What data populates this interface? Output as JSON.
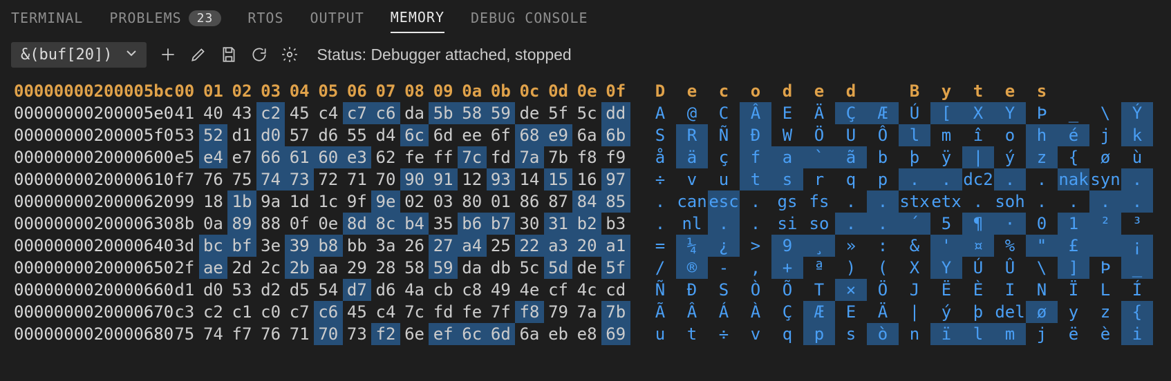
{
  "tabs": [
    {
      "id": "terminal",
      "label": "TERMINAL"
    },
    {
      "id": "problems",
      "label": "PROBLEMS",
      "badge": "23"
    },
    {
      "id": "rtos",
      "label": "RTOS"
    },
    {
      "id": "output",
      "label": "OUTPUT"
    },
    {
      "id": "memory",
      "label": "MEMORY",
      "active": true
    },
    {
      "id": "debugconsole",
      "label": "DEBUG CONSOLE"
    }
  ],
  "toolbar": {
    "expression": "&(buf[20])",
    "status": "Status: Debugger attached, stopped"
  },
  "header": {
    "address": "00000000200005bc",
    "cols": [
      "00",
      "01",
      "02",
      "03",
      "04",
      "05",
      "06",
      "07",
      "08",
      "09",
      "0a",
      "0b",
      "0c",
      "0d",
      "0e",
      "0f"
    ],
    "decoded": [
      "D",
      "e",
      "c",
      "o",
      "d",
      "e",
      "d",
      "",
      "B",
      "y",
      "t",
      "e",
      "s",
      "",
      "",
      ""
    ]
  },
  "rows": [
    {
      "addr": "00000000200005e0",
      "hex": [
        "41",
        "40",
        "43",
        "c2",
        "45",
        "c4",
        "c7",
        "c6",
        "da",
        "5b",
        "58",
        "59",
        "de",
        "5f",
        "5c",
        "dd"
      ],
      "hl": [
        0,
        0,
        0,
        1,
        0,
        0,
        1,
        1,
        0,
        1,
        1,
        1,
        0,
        0,
        0,
        1
      ],
      "dec": [
        "A",
        "@",
        "C",
        "Â",
        "E",
        "Ä",
        "Ç",
        "Æ",
        "Ú",
        "[",
        "X",
        "Y",
        "Þ",
        "_",
        "\\",
        "Ý"
      ]
    },
    {
      "addr": "00000000200005f0",
      "hex": [
        "53",
        "52",
        "d1",
        "d0",
        "57",
        "d6",
        "55",
        "d4",
        "6c",
        "6d",
        "ee",
        "6f",
        "68",
        "e9",
        "6a",
        "6b"
      ],
      "hl": [
        0,
        1,
        0,
        1,
        0,
        0,
        0,
        0,
        1,
        0,
        0,
        0,
        1,
        1,
        0,
        1
      ],
      "dec": [
        "S",
        "R",
        "Ñ",
        "Ð",
        "W",
        "Ö",
        "U",
        "Ô",
        "l",
        "m",
        "î",
        "o",
        "h",
        "é",
        "j",
        "k"
      ]
    },
    {
      "addr": "0000000020000600",
      "hex": [
        "e5",
        "e4",
        "e7",
        "66",
        "61",
        "60",
        "e3",
        "62",
        "fe",
        "ff",
        "7c",
        "fd",
        "7a",
        "7b",
        "f8",
        "f9"
      ],
      "hl": [
        0,
        1,
        0,
        1,
        1,
        1,
        1,
        0,
        0,
        0,
        1,
        0,
        1,
        0,
        0,
        0
      ],
      "dec": [
        "å",
        "ä",
        "ç",
        "f",
        "a",
        "`",
        "ã",
        "b",
        "þ",
        "ÿ",
        "|",
        "ý",
        "z",
        "{",
        "ø",
        "ù"
      ]
    },
    {
      "addr": "0000000020000610",
      "hex": [
        "f7",
        "76",
        "75",
        "74",
        "73",
        "72",
        "71",
        "70",
        "90",
        "91",
        "12",
        "93",
        "14",
        "15",
        "16",
        "97"
      ],
      "hl": [
        0,
        0,
        0,
        1,
        1,
        0,
        0,
        0,
        1,
        1,
        0,
        1,
        0,
        1,
        0,
        1
      ],
      "dec": [
        "÷",
        "v",
        "u",
        "t",
        "s",
        "r",
        "q",
        "p",
        ".",
        ".",
        "dc2",
        ".",
        ".",
        "nak",
        "syn",
        "."
      ]
    },
    {
      "addr": "0000000020000620",
      "hex": [
        "99",
        "18",
        "1b",
        "9a",
        "1d",
        "1c",
        "9f",
        "9e",
        "02",
        "03",
        "80",
        "01",
        "86",
        "87",
        "84",
        "85"
      ],
      "hl": [
        0,
        0,
        1,
        0,
        0,
        0,
        0,
        1,
        0,
        0,
        0,
        0,
        0,
        0,
        1,
        1
      ],
      "dec": [
        ".",
        "can",
        "esc",
        ".",
        "gs",
        "fs",
        ".",
        ".",
        "stx",
        "etx",
        ".",
        "soh",
        ".",
        ".",
        ".",
        "."
      ]
    },
    {
      "addr": "0000000020000630",
      "hex": [
        "8b",
        "0a",
        "89",
        "88",
        "0f",
        "0e",
        "8d",
        "8c",
        "b4",
        "35",
        "b6",
        "b7",
        "30",
        "31",
        "b2",
        "b3"
      ],
      "hl": [
        0,
        0,
        1,
        0,
        0,
        0,
        1,
        1,
        1,
        0,
        1,
        1,
        0,
        1,
        1,
        0
      ],
      "dec": [
        ".",
        "nl",
        ".",
        ".",
        "si",
        "so",
        ".",
        ".",
        "´",
        "5",
        "¶",
        "·",
        "0",
        "1",
        "²",
        "³"
      ]
    },
    {
      "addr": "0000000020000640",
      "hex": [
        "3d",
        "bc",
        "bf",
        "3e",
        "39",
        "b8",
        "bb",
        "3a",
        "26",
        "27",
        "a4",
        "25",
        "22",
        "a3",
        "20",
        "a1"
      ],
      "hl": [
        0,
        1,
        1,
        0,
        1,
        1,
        0,
        0,
        0,
        1,
        1,
        0,
        1,
        1,
        1,
        1
      ],
      "dec": [
        "=",
        "¼",
        "¿",
        ">",
        "9",
        "¸",
        "»",
        ":",
        "&",
        "'",
        "¤",
        "%",
        "\"",
        "£",
        " ",
        "¡"
      ]
    },
    {
      "addr": "0000000020000650",
      "hex": [
        "2f",
        "ae",
        "2d",
        "2c",
        "2b",
        "aa",
        "29",
        "28",
        "58",
        "59",
        "da",
        "db",
        "5c",
        "5d",
        "de",
        "5f"
      ],
      "hl": [
        0,
        1,
        0,
        0,
        1,
        0,
        0,
        0,
        0,
        1,
        0,
        0,
        0,
        1,
        0,
        1
      ],
      "dec": [
        "/",
        "®",
        "-",
        ",",
        "+",
        "ª",
        ")",
        "(",
        "X",
        "Y",
        "Ú",
        "Û",
        "\\",
        "]",
        "Þ",
        "_"
      ]
    },
    {
      "addr": "0000000020000660",
      "hex": [
        "d1",
        "d0",
        "53",
        "d2",
        "d5",
        "54",
        "d7",
        "d6",
        "4a",
        "cb",
        "c8",
        "49",
        "4e",
        "cf",
        "4c",
        "cd"
      ],
      "hl": [
        0,
        0,
        0,
        0,
        0,
        0,
        1,
        0,
        0,
        0,
        0,
        0,
        0,
        0,
        0,
        0
      ],
      "dec": [
        "Ñ",
        "Ð",
        "S",
        "Ò",
        "Õ",
        "T",
        "×",
        "Ö",
        "J",
        "Ë",
        "È",
        "I",
        "N",
        "Ï",
        "L",
        "Í"
      ]
    },
    {
      "addr": "0000000020000670",
      "hex": [
        "c3",
        "c2",
        "c1",
        "c0",
        "c7",
        "c6",
        "45",
        "c4",
        "7c",
        "fd",
        "fe",
        "7f",
        "f8",
        "79",
        "7a",
        "7b"
      ],
      "hl": [
        0,
        0,
        0,
        0,
        0,
        1,
        0,
        0,
        0,
        0,
        0,
        0,
        1,
        0,
        0,
        1
      ],
      "dec": [
        "Ã",
        "Â",
        "Á",
        "À",
        "Ç",
        "Æ",
        "E",
        "Ä",
        "|",
        "ý",
        "þ",
        "del",
        "ø",
        "y",
        "z",
        "{"
      ]
    },
    {
      "addr": "0000000020000680",
      "hex": [
        "75",
        "74",
        "f7",
        "76",
        "71",
        "70",
        "73",
        "f2",
        "6e",
        "ef",
        "6c",
        "6d",
        "6a",
        "eb",
        "e8",
        "69"
      ],
      "hl": [
        0,
        0,
        0,
        0,
        0,
        1,
        0,
        1,
        0,
        1,
        1,
        1,
        0,
        0,
        0,
        1
      ],
      "dec": [
        "u",
        "t",
        "÷",
        "v",
        "q",
        "p",
        "s",
        "ò",
        "n",
        "ï",
        "l",
        "m",
        "j",
        "ë",
        "è",
        "i"
      ]
    }
  ]
}
